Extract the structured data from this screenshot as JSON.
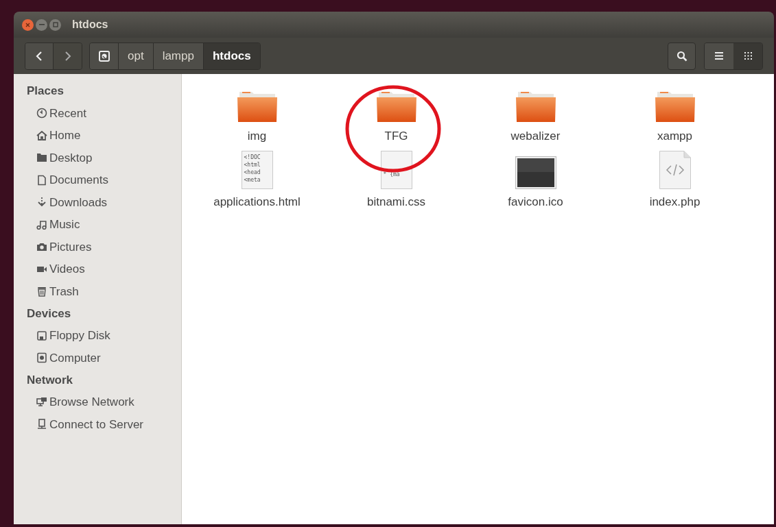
{
  "window": {
    "title": "htdocs"
  },
  "path_bar": [
    {
      "label": "opt",
      "selected": false
    },
    {
      "label": "lampp",
      "selected": false
    },
    {
      "label": "htdocs",
      "selected": true
    }
  ],
  "view_buttons": [
    {
      "selected": false
    },
    {
      "selected": true
    }
  ],
  "sidebar": {
    "sections": [
      {
        "heading": "Places",
        "items": [
          "Recent",
          "Home",
          "Desktop",
          "Documents",
          "Downloads",
          "Music",
          "Pictures",
          "Videos",
          "Trash"
        ]
      },
      {
        "heading": "Devices",
        "items": [
          "Floppy Disk",
          "Computer"
        ]
      },
      {
        "heading": "Network",
        "items": [
          "Browse Network",
          "Connect to Server"
        ]
      }
    ]
  },
  "files": [
    {
      "name": "img",
      "kind": "folder"
    },
    {
      "name": "TFG",
      "kind": "folder"
    },
    {
      "name": "webalizer",
      "kind": "folder"
    },
    {
      "name": "xampp",
      "kind": "folder"
    },
    {
      "name": "applications.html",
      "kind": "text",
      "preview": [
        "<!DOC",
        "<html",
        "<head",
        "<meta"
      ]
    },
    {
      "name": "bitnami.css",
      "kind": "text",
      "preview": [
        "* {ma"
      ]
    },
    {
      "name": "favicon.ico",
      "kind": "image"
    },
    {
      "name": "index.php",
      "kind": "code"
    }
  ],
  "annotation": {
    "kind": "circle"
  }
}
